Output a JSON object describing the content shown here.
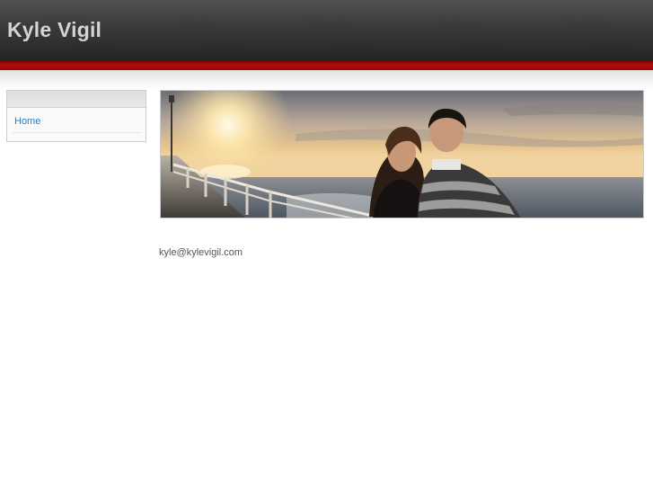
{
  "header": {
    "site_title": "Kyle Vigil"
  },
  "sidebar": {
    "items": [
      {
        "label": "Home"
      }
    ]
  },
  "main": {
    "contact_email": "kyle@kylevigil.com"
  },
  "colors": {
    "accent_red": "#b30d0d",
    "header_dark": "#2b2b2b",
    "link_blue": "#2a7fc1"
  }
}
